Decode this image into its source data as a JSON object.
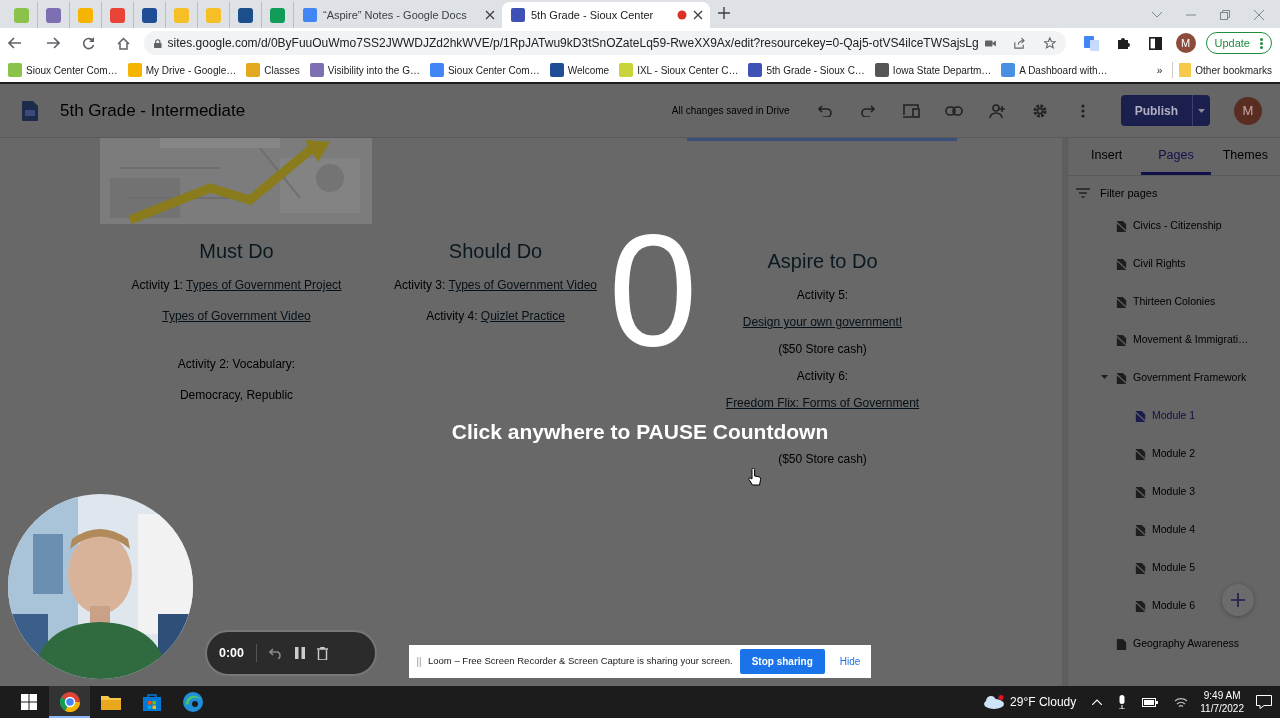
{
  "browser": {
    "tabs": [
      {
        "kind": "icon",
        "color": "#8bc34a",
        "selected": false
      },
      {
        "kind": "icon",
        "color": "#7e6fb3",
        "selected": false
      },
      {
        "kind": "icon",
        "color": "#f4b400",
        "selected": false
      },
      {
        "kind": "icon",
        "color": "#ea4335",
        "selected": false
      },
      {
        "kind": "icon",
        "color": "#1f4e96",
        "selected": false
      },
      {
        "kind": "icon",
        "color": "#f6bf26",
        "selected": false
      },
      {
        "kind": "icon",
        "color": "#f6bf26",
        "selected": false
      },
      {
        "kind": "icon",
        "color": "#1a4f8b",
        "selected": false
      },
      {
        "kind": "icon",
        "color": "#0f9d58",
        "selected": false
      },
      {
        "kind": "page",
        "label": "“Aspire” Notes - Google Docs",
        "color": "#4285f4",
        "selected": false,
        "recording": false
      },
      {
        "kind": "page",
        "label": "5th Grade - Sioux Center",
        "color": "#3f51b5",
        "selected": true,
        "recording": true
      }
    ],
    "url": "sites.google.com/d/0ByFuuOuWmo7SS2JWWDJZd2hkWVE/p/1RpJATwu9kD3tSnOZateLq59-RweXX9Ax/edit?resourcekey=0-Qaj5-otVS4ilceTWSajsLg",
    "account_initial": "M",
    "update_label": "Update",
    "bookmarks": [
      {
        "label": "Sioux Center Com…",
        "color": "#8bc34a"
      },
      {
        "label": "My Drive - Google…",
        "color": "#f4b400"
      },
      {
        "label": "Classes",
        "color": "#e3a81d"
      },
      {
        "label": "Visibility into the G…",
        "color": "#7e6fb3"
      },
      {
        "label": "Sioux Center Com…",
        "color": "#4285f4"
      },
      {
        "label": "Welcome",
        "color": "#1f4e96"
      },
      {
        "label": "IXL - Sioux Center C…",
        "color": "#c9d33a"
      },
      {
        "label": "5th Grade - Sioux C…",
        "color": "#3f51b5"
      },
      {
        "label": "Iowa State Departm…",
        "color": "#555555"
      },
      {
        "label": "A Dashboard with…",
        "color": "#4a90e2"
      }
    ],
    "more_label": "»",
    "other_bookmarks": "Other bookmarks"
  },
  "site_header": {
    "title": "5th Grade - Intermediate",
    "save_status": "All changes saved in Drive",
    "publish_label": "Publish",
    "avatar_initial": "M"
  },
  "content": {
    "columns": [
      {
        "heading": "Must Do",
        "blocks": [
          [
            {
              "text": "Activity 1: ",
              "link": "Types of Government Project"
            },
            {
              "link": "Types of Government Video"
            }
          ],
          [
            {
              "text": "Activity 2: Vocabulary:"
            },
            {
              "text": "Democracy, Republic"
            }
          ]
        ]
      },
      {
        "heading": "Should Do",
        "blocks": [
          [
            {
              "text": "Activity 3: ",
              "link": "Types of Government Video"
            },
            {
              "text": "Activity 4: ",
              "link": "Quizlet Practice"
            }
          ]
        ]
      },
      {
        "heading": "Aspire to Do",
        "blocks": [
          [
            {
              "text": "Activity 5:"
            },
            {
              "link": "Design your own government!"
            },
            {
              "text": "($50 Store cash)"
            },
            {
              "text": "Activity 6:"
            },
            {
              "link": "Freedom Flix: Forms of Government"
            },
            {
              "text": "($50 Store cash)"
            }
          ]
        ]
      }
    ]
  },
  "sidebar": {
    "tabs": [
      {
        "label": "Insert",
        "selected": false
      },
      {
        "label": "Pages",
        "selected": true
      },
      {
        "label": "Themes",
        "selected": false
      }
    ],
    "filter": {
      "placeholder": "Filter pages"
    },
    "pages": [
      {
        "label": "Civics - Citizenship",
        "hidden": true,
        "selected": false
      },
      {
        "label": "Civil Rights",
        "hidden": true,
        "selected": false
      },
      {
        "label": "Thirteen Colonies",
        "hidden": true,
        "selected": false
      },
      {
        "label": "Movement & Immigrati…",
        "hidden": true,
        "selected": false
      },
      {
        "label": "Government Framework",
        "hidden": true,
        "selected": false,
        "expanded": true,
        "children": [
          {
            "label": "Module 1",
            "hidden": true,
            "selected": true
          },
          {
            "label": "Module 2",
            "hidden": true,
            "selected": false
          },
          {
            "label": "Module 3",
            "hidden": true,
            "selected": false
          },
          {
            "label": "Module 4",
            "hidden": true,
            "selected": false
          },
          {
            "label": "Module 5",
            "hidden": true,
            "selected": false
          },
          {
            "label": "Module 6",
            "hidden": true,
            "selected": false
          }
        ]
      },
      {
        "label": "Geography Awareness",
        "hidden": false,
        "selected": false
      }
    ]
  },
  "countdown": {
    "count": "0",
    "prompt": "Click anywhere to PAUSE Countdown"
  },
  "recorder": {
    "time": "0:00"
  },
  "sharing_bar": {
    "message": "Loom – Free Screen Recorder & Screen Capture is sharing your screen.",
    "stop_label": "Stop sharing",
    "hide_label": "Hide"
  },
  "taskbar": {
    "weather": "29°F Cloudy",
    "time": "9:49 AM",
    "date": "11/7/2022"
  }
}
